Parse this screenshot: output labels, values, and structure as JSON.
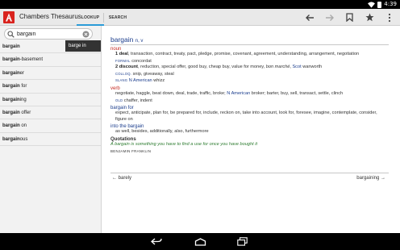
{
  "status": {
    "time": "4:39"
  },
  "app": {
    "title": "Chambers Thesaurus"
  },
  "tabs": [
    {
      "label": "LOOKUP"
    },
    {
      "label": "SEARCH"
    }
  ],
  "toolbar_icons": [
    "back-arrow-icon",
    "forward-arrow-icon",
    "bookmark-icon",
    "star-icon",
    "overflow-menu-icon"
  ],
  "search": {
    "value": "bargain",
    "placeholder": ""
  },
  "popup": {
    "label": "barge in"
  },
  "word_list": [
    {
      "bold": "bargain",
      "rest": ""
    },
    {
      "bold": "bargain",
      "rest": "-basement"
    },
    {
      "bold": "bargain",
      "rest": "er"
    },
    {
      "bold": "bargain",
      "rest": " for"
    },
    {
      "bold": "bargain",
      "rest": "ing"
    },
    {
      "bold": "bargain",
      "rest": " offer"
    },
    {
      "bold": "bargain",
      "rest": " on"
    },
    {
      "bold": "bargain",
      "rest": "ous"
    }
  ],
  "entry": {
    "headword": "bargain",
    "pos": "n, v",
    "noun_label": "noun",
    "sense1_num": "1",
    "sense1_key": "deal",
    "sense1_text": ", transaction, contract, treaty, pact, pledge, promise, covenant, agreement, understanding, arrangement, negotiation",
    "sense1_formal_label": "FORMAL",
    "sense1_formal_text": " concordat",
    "sense2_num": "2",
    "sense2_key": "discount",
    "sense2_text": ", reduction, special offer, good buy, cheap buy, value for money, ",
    "sense2_italic": "bon marché",
    "sense2_comma": ", ",
    "sense2_scot": "Scot",
    "sense2_scot_text": " wanworth",
    "colloq_label": "COLLOQ.",
    "colloq_text": " snip, giveaway, steal",
    "slang_label": "SLANG",
    "slang_region": " N American",
    "slang_text": " whizz",
    "verb_label": "verb",
    "verb_text1": "negotiate, haggle, beat down, deal, trade, traffic, broke; ",
    "verb_region": "N American",
    "verb_text2": " broker; barter, buy, sell, transact, settle, clinch",
    "old_label": "OLD",
    "old_text": " chaffer, indent",
    "sub1_head": "bargain for",
    "sub1_text": "expect, anticipate, plan for, be prepared for, include, reckon on, take into account, look for, foresee, imagine, contemplate, consider, figure on",
    "sub2_head": "into the bargain",
    "sub2_text": "as well, besides, additionally, also, furthermore",
    "quotations_head": "Quotations",
    "quote": "A bargain is something you have to find a use for once you have bought it",
    "author": "BENJAMIN FRANKLIN"
  },
  "nav": {
    "prev": "← barely",
    "next": "bargaining →"
  },
  "system_nav": [
    "back-icon",
    "home-icon",
    "recent-apps-icon"
  ],
  "colors": {
    "accent": "#2b9bd7",
    "headword": "#1a3c8c",
    "pos_label": "#c4271f",
    "quote": "#2f7d32",
    "logo": "#d9231e"
  }
}
